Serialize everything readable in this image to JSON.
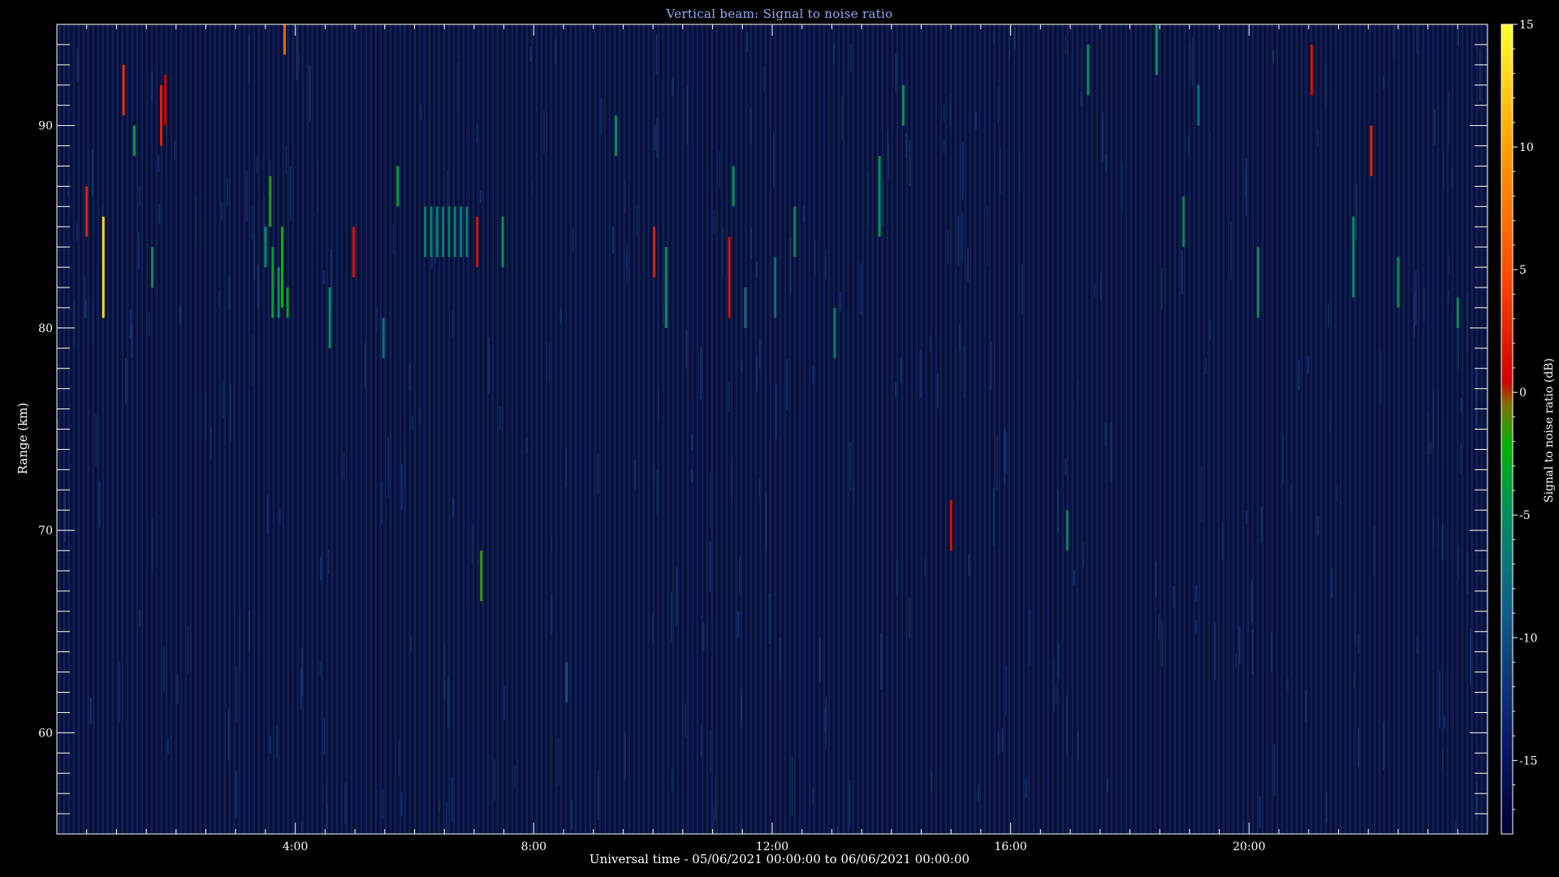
{
  "chart_data": {
    "type": "heatmap",
    "title": "Vertical beam: Signal to noise ratio",
    "xlabel": "Universal time - 05/06/2021 00:00:00 to 06/06/2021 00:00:00",
    "ylabel": "Range (km)",
    "colorbar_label": "Signal to noise ratio (dB)",
    "xlim_hours": [
      0,
      24
    ],
    "ylim_km": [
      55,
      95
    ],
    "clim_db": [
      -18,
      15
    ],
    "x_ticks": [
      {
        "hour": 4,
        "label": "4:00"
      },
      {
        "hour": 8,
        "label": "8:00"
      },
      {
        "hour": 12,
        "label": "12:00"
      },
      {
        "hour": 16,
        "label": "16:00"
      },
      {
        "hour": 20,
        "label": "20:00"
      }
    ],
    "y_ticks": [
      {
        "km": 60,
        "label": "60"
      },
      {
        "km": 70,
        "label": "70"
      },
      {
        "km": 80,
        "label": "80"
      },
      {
        "km": 90,
        "label": "90"
      }
    ],
    "colorbar_ticks": [
      {
        "db": 15,
        "label": "15"
      },
      {
        "db": 10,
        "label": "10"
      },
      {
        "db": 5,
        "label": "5"
      },
      {
        "db": 0,
        "label": "0"
      },
      {
        "db": -5,
        "label": "-5"
      },
      {
        "db": -10,
        "label": "-10"
      },
      {
        "db": -15,
        "label": "-15"
      }
    ],
    "background_db": -15,
    "echoes": [
      {
        "t": 0.5,
        "z0": 84.5,
        "z1": 87.0,
        "snr": 2
      },
      {
        "t": 0.78,
        "z0": 80.5,
        "z1": 85.5,
        "snr": 13
      },
      {
        "t": 1.12,
        "z0": 90.5,
        "z1": 93.0,
        "snr": 3
      },
      {
        "t": 1.3,
        "z0": 88.5,
        "z1": 90.0,
        "snr": -5
      },
      {
        "t": 1.6,
        "z0": 82.0,
        "z1": 84.0,
        "snr": -6
      },
      {
        "t": 1.75,
        "z0": 89.0,
        "z1": 92.0,
        "snr": 2
      },
      {
        "t": 1.82,
        "z0": 90.0,
        "z1": 92.5,
        "snr": 0
      },
      {
        "t": 3.5,
        "z0": 83.0,
        "z1": 85.0,
        "snr": -6
      },
      {
        "t": 3.58,
        "z0": 85.0,
        "z1": 87.5,
        "snr": -3
      },
      {
        "t": 3.62,
        "z0": 80.5,
        "z1": 84.0,
        "snr": -5
      },
      {
        "t": 3.72,
        "z0": 80.5,
        "z1": 83.0,
        "snr": -6
      },
      {
        "t": 3.78,
        "z0": 81.0,
        "z1": 85.0,
        "snr": -4
      },
      {
        "t": 3.82,
        "z0": 93.5,
        "z1": 95.0,
        "snr": 6
      },
      {
        "t": 3.87,
        "z0": 80.5,
        "z1": 82.0,
        "snr": -5
      },
      {
        "t": 4.58,
        "z0": 79.0,
        "z1": 82.0,
        "snr": -6
      },
      {
        "t": 4.98,
        "z0": 82.5,
        "z1": 85.0,
        "snr": 1
      },
      {
        "t": 5.48,
        "z0": 78.5,
        "z1": 80.5,
        "snr": -8
      },
      {
        "t": 5.72,
        "z0": 86.0,
        "z1": 88.0,
        "snr": -5
      },
      {
        "t": 6.18,
        "z0": 83.5,
        "z1": 86.0,
        "snr": -7
      },
      {
        "t": 6.28,
        "z0": 83.5,
        "z1": 86.0,
        "snr": -7
      },
      {
        "t": 6.38,
        "z0": 83.5,
        "z1": 86.0,
        "snr": -7
      },
      {
        "t": 6.48,
        "z0": 83.5,
        "z1": 86.0,
        "snr": -7
      },
      {
        "t": 6.58,
        "z0": 83.5,
        "z1": 86.0,
        "snr": -7
      },
      {
        "t": 6.68,
        "z0": 83.5,
        "z1": 86.0,
        "snr": -7
      },
      {
        "t": 6.78,
        "z0": 83.5,
        "z1": 86.0,
        "snr": -7
      },
      {
        "t": 6.88,
        "z0": 83.5,
        "z1": 86.0,
        "snr": -7
      },
      {
        "t": 7.05,
        "z0": 83.0,
        "z1": 85.5,
        "snr": 1
      },
      {
        "t": 7.12,
        "z0": 66.5,
        "z1": 69.0,
        "snr": -3
      },
      {
        "t": 7.48,
        "z0": 83.0,
        "z1": 85.5,
        "snr": -6
      },
      {
        "t": 8.55,
        "z0": 61.5,
        "z1": 63.5,
        "snr": -10
      },
      {
        "t": 9.38,
        "z0": 88.5,
        "z1": 90.5,
        "snr": -6
      },
      {
        "t": 10.02,
        "z0": 82.5,
        "z1": 85.0,
        "snr": 2
      },
      {
        "t": 10.22,
        "z0": 80.0,
        "z1": 84.0,
        "snr": -6
      },
      {
        "t": 11.28,
        "z0": 80.5,
        "z1": 84.5,
        "snr": 1
      },
      {
        "t": 11.35,
        "z0": 86.0,
        "z1": 88.0,
        "snr": -6
      },
      {
        "t": 11.55,
        "z0": 80.0,
        "z1": 82.0,
        "snr": -8
      },
      {
        "t": 12.05,
        "z0": 80.5,
        "z1": 83.5,
        "snr": -8
      },
      {
        "t": 12.38,
        "z0": 83.5,
        "z1": 86.0,
        "snr": -6
      },
      {
        "t": 13.05,
        "z0": 78.5,
        "z1": 81.0,
        "snr": -7
      },
      {
        "t": 13.8,
        "z0": 84.5,
        "z1": 88.5,
        "snr": -6
      },
      {
        "t": 14.2,
        "z0": 90.0,
        "z1": 92.0,
        "snr": -6
      },
      {
        "t": 15.0,
        "z0": 69.0,
        "z1": 71.5,
        "snr": 1
      },
      {
        "t": 16.95,
        "z0": 69.0,
        "z1": 71.0,
        "snr": -7
      },
      {
        "t": 17.3,
        "z0": 91.5,
        "z1": 94.0,
        "snr": -6
      },
      {
        "t": 18.45,
        "z0": 92.5,
        "z1": 95.0,
        "snr": -6
      },
      {
        "t": 18.9,
        "z0": 84.0,
        "z1": 86.5,
        "snr": -7
      },
      {
        "t": 19.15,
        "z0": 90.0,
        "z1": 92.0,
        "snr": -8
      },
      {
        "t": 20.15,
        "z0": 80.5,
        "z1": 84.0,
        "snr": -6
      },
      {
        "t": 21.05,
        "z0": 91.5,
        "z1": 94.0,
        "snr": 1
      },
      {
        "t": 21.75,
        "z0": 81.5,
        "z1": 85.5,
        "snr": -6
      },
      {
        "t": 22.05,
        "z0": 87.5,
        "z1": 90.0,
        "snr": 2
      },
      {
        "t": 22.5,
        "z0": 81.0,
        "z1": 83.5,
        "snr": -6
      },
      {
        "t": 23.5,
        "z0": 80.0,
        "z1": 81.5,
        "snr": -6
      }
    ]
  }
}
